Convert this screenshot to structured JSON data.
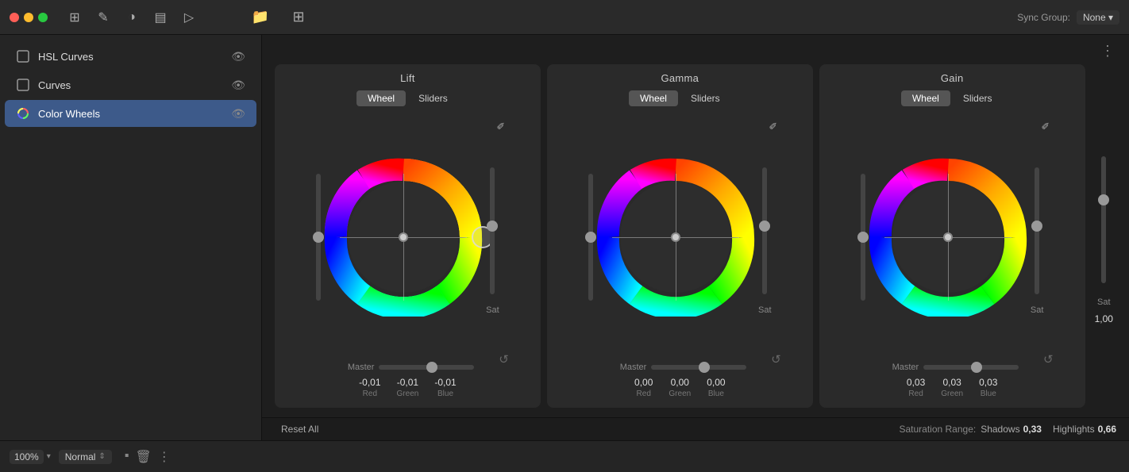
{
  "titlebar": {
    "sync_group_label": "Sync Group:",
    "sync_group_value": "None ▾"
  },
  "sidebar": {
    "items": [
      {
        "id": "hsl-curves",
        "label": "HSL Curves",
        "active": false,
        "icon": "☐"
      },
      {
        "id": "curves",
        "label": "Curves",
        "active": false,
        "icon": "☐"
      },
      {
        "id": "color-wheels",
        "label": "Color Wheels",
        "active": true,
        "icon": "✦"
      }
    ]
  },
  "wheels": [
    {
      "title": "Lift",
      "active_tab": "Wheel",
      "tabs": [
        "Wheel",
        "Sliders"
      ],
      "values": {
        "red": "-0,01",
        "green": "-0,01",
        "blue": "-0,01"
      },
      "master_pos": 0.5,
      "sat_pos": 0.5
    },
    {
      "title": "Gamma",
      "active_tab": "Wheel",
      "tabs": [
        "Wheel",
        "Sliders"
      ],
      "values": {
        "red": "0,00",
        "green": "0,00",
        "blue": "0,00"
      },
      "master_pos": 0.5,
      "sat_pos": 0.5
    },
    {
      "title": "Gain",
      "active_tab": "Wheel",
      "tabs": [
        "Wheel",
        "Sliders"
      ],
      "values": {
        "red": "0,03",
        "green": "0,03",
        "blue": "0,03"
      },
      "master_pos": 0.5,
      "sat_pos": 0.5
    }
  ],
  "sat_right": {
    "value": "1,00"
  },
  "bottom": {
    "zoom": "100%",
    "mode": "Normal",
    "reset_all": "Reset All",
    "saturation_range_label": "Saturation Range:",
    "shadows_label": "Shadows",
    "shadows_value": "0,33",
    "highlights_label": "Highlights",
    "highlights_value": "0,66"
  },
  "labels": {
    "master": "Master",
    "sat": "Sat",
    "red": "Red",
    "green": "Green",
    "blue": "Blue"
  }
}
